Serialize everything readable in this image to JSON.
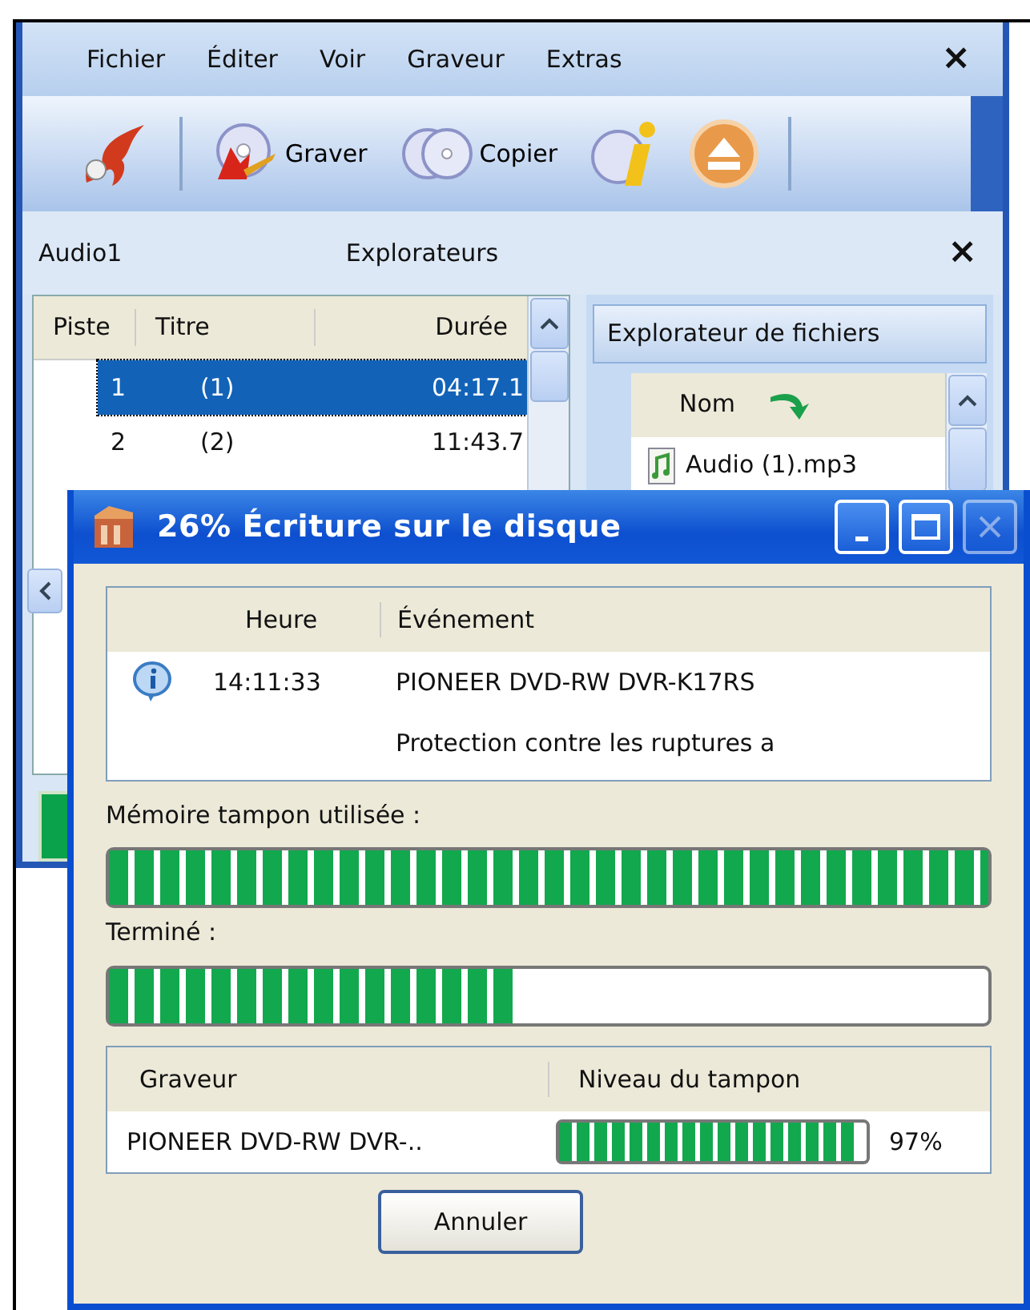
{
  "menu": [
    {
      "label": "Fichier"
    },
    {
      "label": "Éditer"
    },
    {
      "label": "Voir"
    },
    {
      "label": "Graveur"
    },
    {
      "label": "Extras"
    }
  ],
  "menu_close": "×",
  "toolbar": [
    {
      "kind": "logo"
    },
    {
      "kind": "burn",
      "label": "Graver"
    },
    {
      "kind": "copy",
      "label": "Copier"
    },
    {
      "kind": "info"
    },
    {
      "kind": "eject"
    }
  ],
  "project": {
    "title": "Audio1",
    "columns": [
      "Piste",
      "Titre",
      "Durée"
    ],
    "rows": [
      {
        "cells": [
          "1",
          "(1)",
          "04:17.1"
        ],
        "selected": true
      },
      {
        "cells": [
          "2",
          "(2)",
          "11:43.7"
        ],
        "selected": false
      }
    ]
  },
  "explorer": {
    "title": "Explorateurs",
    "close": "×",
    "tab": "Explorateur de fichiers",
    "column": "Nom",
    "files": [
      "Audio (1).mp3"
    ]
  },
  "dialog": {
    "title": "26% Écriture sur le disque",
    "log_columns": [
      "Heure",
      "Événement"
    ],
    "log": [
      {
        "kind": "info",
        "time": "14:11:33",
        "event": "PIONEER DVD-RW DVR-K17RS"
      },
      {
        "kind": "none",
        "event": "Protection contre les ruptures a"
      }
    ],
    "buffer_label": "Mémoire tampon utilisée :",
    "buffer": {
      "level": 1.0
    },
    "done_label": "Terminé :",
    "done": {
      "level": 0.46
    },
    "drive_columns": [
      "Graveur",
      "Niveau du tampon"
    ],
    "drives": [
      {
        "name": "PIONEER DVD-RW DVR-..",
        "level": 0.97,
        "reading": "97%"
      }
    ],
    "cancel": "Annuler"
  }
}
